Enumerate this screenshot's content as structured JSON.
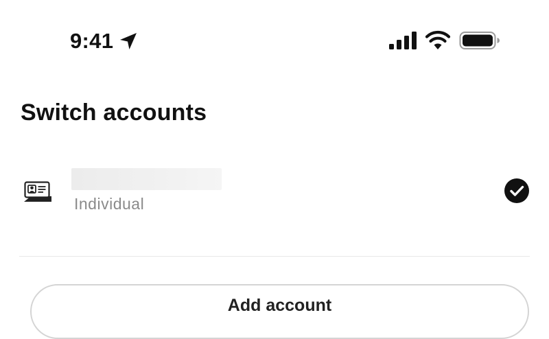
{
  "status_bar": {
    "time": "9:41",
    "icons": [
      "location-arrow-icon",
      "cellular-signal-icon",
      "wifi-icon",
      "battery-icon"
    ]
  },
  "page": {
    "title": "Switch accounts"
  },
  "accounts": [
    {
      "name": "",
      "type": "Individual",
      "icon": "id-card-icon",
      "selected": true
    }
  ],
  "actions": {
    "add_account_label": "Add account"
  },
  "colors": {
    "text_primary": "#111111",
    "text_secondary": "#8a8a8a",
    "divider": "#e8e8e8",
    "button_border": "#d4d4d4",
    "check_fill": "#111111"
  }
}
